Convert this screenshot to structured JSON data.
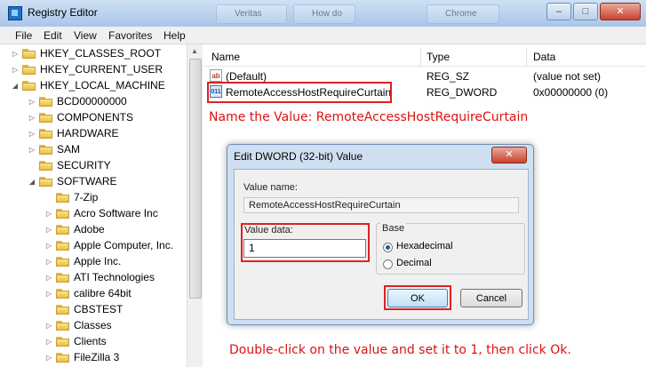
{
  "window": {
    "title": "Registry Editor",
    "ghost_tabs": [
      "Veritas",
      "How do",
      "Chrome"
    ]
  },
  "window_buttons": {
    "minimize": "–",
    "maximize": "□",
    "close": "✕"
  },
  "menu": [
    "File",
    "Edit",
    "View",
    "Favorites",
    "Help"
  ],
  "tree": [
    {
      "label": "HKEY_CLASSES_ROOT",
      "expander": "▷"
    },
    {
      "label": "HKEY_CURRENT_USER",
      "expander": "▷"
    },
    {
      "label": "HKEY_LOCAL_MACHINE",
      "expander": "◢"
    },
    {
      "label": "BCD00000000",
      "expander": "▷"
    },
    {
      "label": "COMPONENTS",
      "expander": "▷"
    },
    {
      "label": "HARDWARE",
      "expander": "▷"
    },
    {
      "label": "SAM",
      "expander": "▷"
    },
    {
      "label": "SECURITY",
      "expander": ""
    },
    {
      "label": "SOFTWARE",
      "expander": "◢"
    },
    {
      "label": "7-Zip",
      "expander": ""
    },
    {
      "label": "Acro Software Inc",
      "expander": "▷"
    },
    {
      "label": "Adobe",
      "expander": "▷"
    },
    {
      "label": "Apple Computer, Inc.",
      "expander": "▷"
    },
    {
      "label": "Apple Inc.",
      "expander": "▷"
    },
    {
      "label": "ATI Technologies",
      "expander": "▷"
    },
    {
      "label": "calibre 64bit",
      "expander": "▷"
    },
    {
      "label": "CBSTEST",
      "expander": ""
    },
    {
      "label": "Classes",
      "expander": "▷"
    },
    {
      "label": "Clients",
      "expander": "▷"
    },
    {
      "label": "FileZilla 3",
      "expander": "▷"
    }
  ],
  "list": {
    "columns": [
      "Name",
      "Type",
      "Data"
    ],
    "rows": [
      {
        "icon": "ab",
        "name": "(Default)",
        "type": "REG_SZ",
        "data": "(value not set)"
      },
      {
        "icon": "011",
        "name": "RemoteAccessHostRequireCurtain",
        "type": "REG_DWORD",
        "data": "0x00000000 (0)"
      }
    ]
  },
  "annotations": {
    "top": "Name the Value: RemoteAccessHostRequireCurtain",
    "bottom": "Double-click on the value and set it to 1, then click Ok."
  },
  "dialog": {
    "title": "Edit DWORD (32-bit) Value",
    "close_label": "✕",
    "value_name_label": "Value name:",
    "value_name": "RemoteAccessHostRequireCurtain",
    "value_data_label": "Value data:",
    "value_data": "1",
    "base_label": "Base",
    "base_options": [
      "Hexadecimal",
      "Decimal"
    ],
    "base_selected": "Hexadecimal",
    "ok_label": "OK",
    "cancel_label": "Cancel"
  },
  "colors": {
    "annotation": "#d11111",
    "highlight_box": "#dd2222"
  }
}
